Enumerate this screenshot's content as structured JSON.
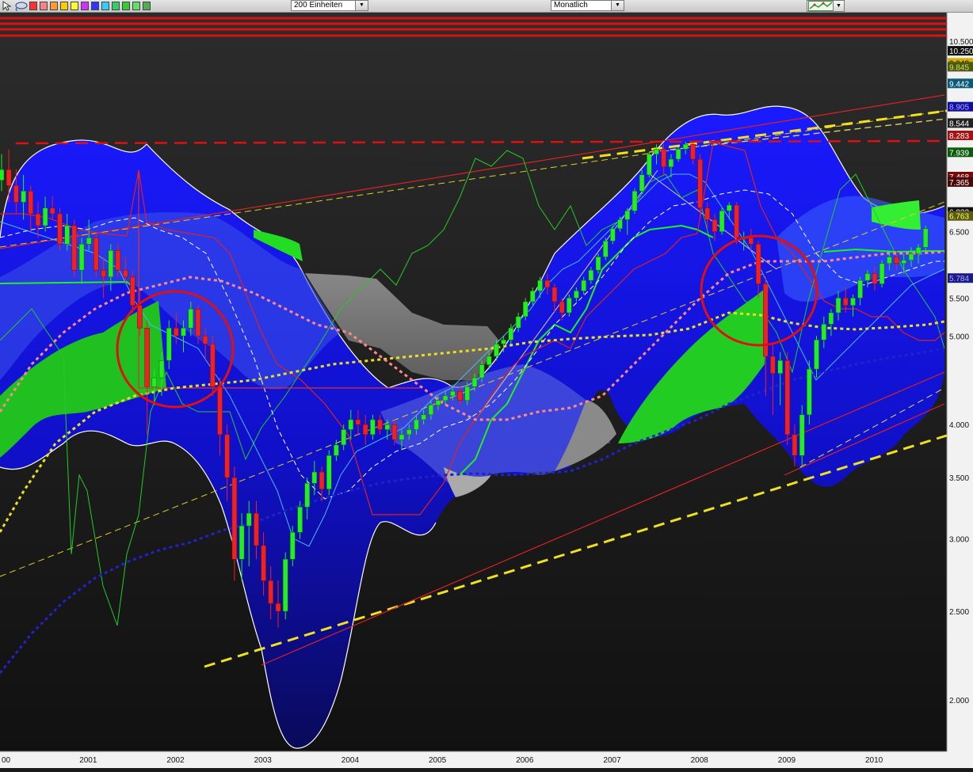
{
  "toolbar": {
    "units_select": "200 Einheiten",
    "period_select": "Monatlich",
    "dropdown_arrow": "▼",
    "tools": [
      "pointer-arrow-icon",
      "lasso-icon"
    ],
    "palette": [
      "#ff3030",
      "#ff8080",
      "#ff9933",
      "#ffcc00",
      "#ffff33",
      "#cc33ff",
      "#3333ff",
      "#33ccff",
      "#33cc66",
      "#33cc33",
      "#66dd66",
      "#55aa55"
    ],
    "chart_type_icon": "chart-style-icon"
  },
  "chart_data": {
    "type": "candlestick",
    "scale": "log",
    "grid": false,
    "ylim": [
      1800,
      10600
    ],
    "x_ticks": [
      "00",
      "2001",
      "2002",
      "2003",
      "2004",
      "2005",
      "2006",
      "2007",
      "2008",
      "2009",
      "2010"
    ],
    "y_ticks": [
      {
        "label": "10.500",
        "value": 10500
      },
      {
        "label": "6.500",
        "value": 6500
      },
      {
        "label": "5.500",
        "value": 5500
      },
      {
        "label": "5.000",
        "value": 5000
      },
      {
        "label": "4.000",
        "value": 4000
      },
      {
        "label": "3.500",
        "value": 3500
      },
      {
        "label": "3.000",
        "value": 3000
      },
      {
        "label": "2.500",
        "value": 2500
      },
      {
        "label": "2.000",
        "value": 2000
      }
    ],
    "price_badges": [
      {
        "label": "10.250",
        "value": 10250,
        "bg": "#111111",
        "fg": "#ffffff"
      },
      {
        "label": "9.943",
        "value": 9943,
        "bg": "#d6b000",
        "fg": "#000000"
      },
      {
        "label": "9.845",
        "value": 9845,
        "bg": "#4a5a10",
        "fg": "#dddd66"
      },
      {
        "label": "9.442",
        "value": 9442,
        "bg": "#0a5a7a",
        "fg": "#ffffff"
      },
      {
        "label": "8.905",
        "value": 8905,
        "bg": "#1010a0",
        "fg": "#aaaaff"
      },
      {
        "label": "8.544",
        "value": 8544,
        "bg": "#222222",
        "fg": "#ffffff"
      },
      {
        "label": "8.283",
        "value": 8283,
        "bg": "#aa1010",
        "fg": "#ffffff"
      },
      {
        "label": "7.939",
        "value": 7939,
        "bg": "#0c5a0c",
        "fg": "#ffffff"
      },
      {
        "label": "7.468",
        "value": 7468,
        "bg": "#7a0a0a",
        "fg": "#ffffff"
      },
      {
        "label": "7.365",
        "value": 7365,
        "bg": "#4a0808",
        "fg": "#ffffff"
      },
      {
        "label": "6.832",
        "value": 6832,
        "bg": "#111111",
        "fg": "#ffffff"
      },
      {
        "label": "6.763",
        "value": 6763,
        "bg": "#5a5a10",
        "fg": "#ffff66"
      },
      {
        "label": "5.784",
        "value": 5784,
        "bg": "#1a1a8a",
        "fg": "#aaaaff"
      }
    ],
    "candles": [
      [
        2000.0,
        7400,
        7900,
        7200,
        7600
      ],
      [
        2000.083,
        7600,
        8000,
        7000,
        7300
      ],
      [
        2000.167,
        7300,
        7600,
        6800,
        7000
      ],
      [
        2000.25,
        7000,
        7500,
        6700,
        7200
      ],
      [
        2000.333,
        7200,
        7300,
        6500,
        6800
      ],
      [
        2000.417,
        6800,
        7000,
        6400,
        6600
      ],
      [
        2000.5,
        6600,
        7100,
        6500,
        6900
      ],
      [
        2000.583,
        6900,
        7100,
        6700,
        6800
      ],
      [
        2000.667,
        6800,
        6900,
        6200,
        6300
      ],
      [
        2000.75,
        6300,
        6800,
        6200,
        6600
      ],
      [
        2000.833,
        6600,
        6700,
        5800,
        5900
      ],
      [
        2000.917,
        5900,
        6400,
        5700,
        6300
      ],
      [
        2001.0,
        6300,
        6700,
        6200,
        6400
      ],
      [
        2001.083,
        6400,
        6500,
        5800,
        5900
      ],
      [
        2001.167,
        5900,
        6100,
        5500,
        5800
      ],
      [
        2001.25,
        5800,
        6300,
        5600,
        6200
      ],
      [
        2001.333,
        6200,
        6300,
        5800,
        5900
      ],
      [
        2001.417,
        5900,
        6100,
        5700,
        5800
      ],
      [
        2001.5,
        5800,
        5900,
        5300,
        5400
      ],
      [
        2001.583,
        5400,
        5600,
        5000,
        5100
      ],
      [
        2001.667,
        5100,
        5200,
        3900,
        4400
      ],
      [
        2001.75,
        4400,
        4600,
        4200,
        4500
      ],
      [
        2001.833,
        4500,
        4800,
        4300,
        4700
      ],
      [
        2001.917,
        4700,
        5200,
        4600,
        5100
      ],
      [
        2002.0,
        5100,
        5300,
        4900,
        5000
      ],
      [
        2002.083,
        5000,
        5200,
        4800,
        5100
      ],
      [
        2002.167,
        5100,
        5450,
        5000,
        5350
      ],
      [
        2002.25,
        5350,
        5400,
        4900,
        5000
      ],
      [
        2002.333,
        5000,
        5100,
        4700,
        4900
      ],
      [
        2002.417,
        4900,
        5000,
        4300,
        4400
      ],
      [
        2002.5,
        4400,
        4500,
        3700,
        3900
      ],
      [
        2002.583,
        3900,
        4000,
        3300,
        3500
      ],
      [
        2002.667,
        3500,
        3600,
        2700,
        2850
      ],
      [
        2002.75,
        2850,
        3200,
        2700,
        3100
      ],
      [
        2002.833,
        3100,
        3300,
        2800,
        3200
      ],
      [
        2002.917,
        3200,
        3300,
        2850,
        2950
      ],
      [
        2003.0,
        2950,
        3050,
        2600,
        2700
      ],
      [
        2003.083,
        2700,
        2800,
        2450,
        2550
      ],
      [
        2003.167,
        2550,
        2700,
        2400,
        2500
      ],
      [
        2003.25,
        2500,
        2900,
        2450,
        2850
      ],
      [
        2003.333,
        2850,
        3100,
        2800,
        3050
      ],
      [
        2003.417,
        3050,
        3300,
        3000,
        3250
      ],
      [
        2003.5,
        3250,
        3500,
        3150,
        3450
      ],
      [
        2003.583,
        3450,
        3650,
        3350,
        3550
      ],
      [
        2003.667,
        3550,
        3600,
        3300,
        3400
      ],
      [
        2003.75,
        3400,
        3750,
        3350,
        3700
      ],
      [
        2003.833,
        3700,
        3850,
        3650,
        3800
      ],
      [
        2003.917,
        3800,
        4000,
        3750,
        3950
      ],
      [
        2004.0,
        3950,
        4150,
        3850,
        4050
      ],
      [
        2004.083,
        4050,
        4150,
        3900,
        4000
      ],
      [
        2004.167,
        4000,
        4100,
        3800,
        3900
      ],
      [
        2004.25,
        3900,
        4100,
        3850,
        4050
      ],
      [
        2004.333,
        4050,
        4100,
        3900,
        3950
      ],
      [
        2004.417,
        3950,
        4050,
        3850,
        4000
      ],
      [
        2004.5,
        4000,
        4050,
        3800,
        3850
      ],
      [
        2004.583,
        3850,
        3950,
        3750,
        3900
      ],
      [
        2004.667,
        3900,
        4000,
        3850,
        3950
      ],
      [
        2004.75,
        3950,
        4100,
        3900,
        4050
      ],
      [
        2004.833,
        4050,
        4150,
        4000,
        4100
      ],
      [
        2004.917,
        4100,
        4250,
        4050,
        4200
      ],
      [
        2005.0,
        4200,
        4300,
        4150,
        4250
      ],
      [
        2005.083,
        4250,
        4350,
        4200,
        4300
      ],
      [
        2005.167,
        4300,
        4400,
        4250,
        4350
      ],
      [
        2005.25,
        4350,
        4400,
        4200,
        4250
      ],
      [
        2005.333,
        4250,
        4450,
        4200,
        4400
      ],
      [
        2005.417,
        4400,
        4550,
        4350,
        4500
      ],
      [
        2005.5,
        4500,
        4700,
        4450,
        4650
      ],
      [
        2005.583,
        4650,
        4800,
        4600,
        4750
      ],
      [
        2005.667,
        4750,
        4950,
        4700,
        4900
      ],
      [
        2005.75,
        4900,
        5000,
        4800,
        4950
      ],
      [
        2005.833,
        4950,
        5150,
        4900,
        5100
      ],
      [
        2005.917,
        5100,
        5300,
        5050,
        5250
      ],
      [
        2006.0,
        5250,
        5500,
        5200,
        5450
      ],
      [
        2006.083,
        5450,
        5650,
        5400,
        5600
      ],
      [
        2006.167,
        5600,
        5800,
        5500,
        5750
      ],
      [
        2006.25,
        5750,
        5850,
        5550,
        5650
      ],
      [
        2006.333,
        5650,
        5700,
        5300,
        5450
      ],
      [
        2006.417,
        5450,
        5500,
        5200,
        5300
      ],
      [
        2006.5,
        5300,
        5550,
        5250,
        5500
      ],
      [
        2006.583,
        5500,
        5650,
        5450,
        5600
      ],
      [
        2006.667,
        5600,
        5800,
        5550,
        5750
      ],
      [
        2006.75,
        5750,
        5950,
        5700,
        5900
      ],
      [
        2006.833,
        5900,
        6150,
        5850,
        6100
      ],
      [
        2006.917,
        6100,
        6400,
        6050,
        6350
      ],
      [
        2007.0,
        6350,
        6600,
        6300,
        6550
      ],
      [
        2007.083,
        6550,
        6750,
        6500,
        6700
      ],
      [
        2007.167,
        6700,
        6900,
        6450,
        6850
      ],
      [
        2007.25,
        6850,
        7250,
        6800,
        7200
      ],
      [
        2007.333,
        7200,
        7600,
        7150,
        7500
      ],
      [
        2007.417,
        7500,
        7950,
        7450,
        7900
      ],
      [
        2007.5,
        7900,
        8100,
        7700,
        8000
      ],
      [
        2007.583,
        8000,
        8100,
        7500,
        7650
      ],
      [
        2007.667,
        7650,
        7900,
        7450,
        7800
      ],
      [
        2007.75,
        7800,
        8050,
        7750,
        8000
      ],
      [
        2007.833,
        8000,
        8150,
        7900,
        8100
      ],
      [
        2007.917,
        8100,
        8150,
        7700,
        7800
      ],
      [
        2008.0,
        7800,
        7900,
        6700,
        6900
      ],
      [
        2008.083,
        6900,
        7000,
        6550,
        6700
      ],
      [
        2008.167,
        6700,
        6800,
        6350,
        6500
      ],
      [
        2008.25,
        6500,
        6900,
        6450,
        6850
      ],
      [
        2008.333,
        6850,
        7000,
        6700,
        6950
      ],
      [
        2008.417,
        6950,
        7000,
        6300,
        6400
      ],
      [
        2008.5,
        6400,
        6500,
        6200,
        6400
      ],
      [
        2008.583,
        6400,
        6550,
        6200,
        6300
      ],
      [
        2008.667,
        6300,
        6350,
        5500,
        5700
      ],
      [
        2008.75,
        5700,
        5800,
        4300,
        4750
      ],
      [
        2008.833,
        4750,
        4900,
        4100,
        4550
      ],
      [
        2008.917,
        4550,
        4800,
        4200,
        4700
      ],
      [
        2009.0,
        4700,
        4800,
        3800,
        3900
      ],
      [
        2009.083,
        3900,
        4000,
        3600,
        3700
      ],
      [
        2009.167,
        3700,
        4200,
        3600,
        4100
      ],
      [
        2009.25,
        4100,
        4700,
        4000,
        4600
      ],
      [
        2009.333,
        4600,
        5000,
        4500,
        4950
      ],
      [
        2009.417,
        4950,
        5250,
        4850,
        5150
      ],
      [
        2009.5,
        5150,
        5350,
        5000,
        5300
      ],
      [
        2009.583,
        5300,
        5600,
        5200,
        5500
      ],
      [
        2009.667,
        5500,
        5650,
        5300,
        5400
      ],
      [
        2009.75,
        5400,
        5550,
        5250,
        5500
      ],
      [
        2009.833,
        5500,
        5800,
        5400,
        5750
      ],
      [
        2009.917,
        5750,
        5900,
        5650,
        5850
      ],
      [
        2010.0,
        5850,
        5950,
        5600,
        5700
      ],
      [
        2010.083,
        5700,
        6050,
        5650,
        6000
      ],
      [
        2010.167,
        6000,
        6200,
        5900,
        6100
      ],
      [
        2010.25,
        6100,
        6200,
        5900,
        6000
      ],
      [
        2010.333,
        6000,
        6150,
        5850,
        6050
      ],
      [
        2010.417,
        6050,
        6250,
        5950,
        6150
      ],
      [
        2010.5,
        6150,
        6300,
        6000,
        6250
      ],
      [
        2010.583,
        6250,
        6600,
        6200,
        6550
      ]
    ]
  }
}
